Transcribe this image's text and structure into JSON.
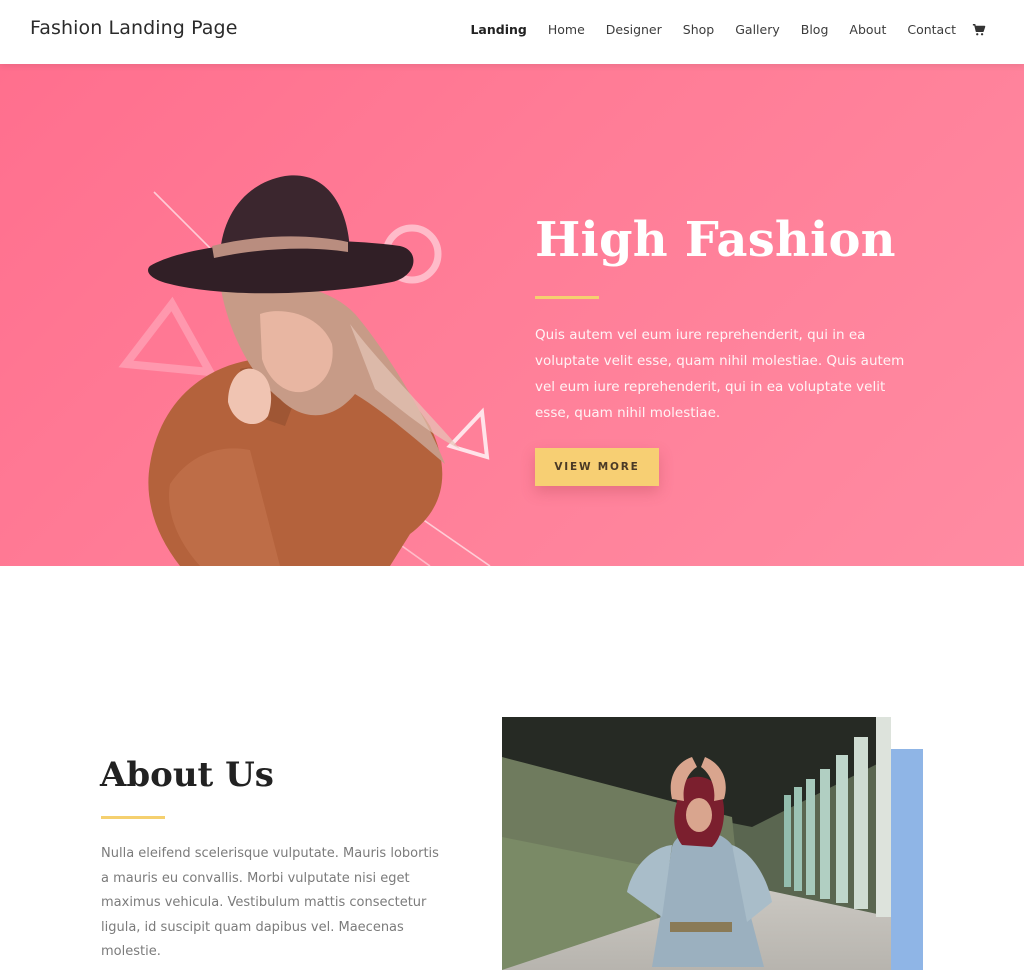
{
  "header": {
    "logo": "Fashion Landing Page",
    "nav": [
      "Landing",
      "Home",
      "Designer",
      "Shop",
      "Gallery",
      "Blog",
      "About",
      "Contact"
    ],
    "active_index": 0,
    "cart_icon": "shopping-cart-icon"
  },
  "hero": {
    "title": "High Fashion",
    "text": "Quis autem vel eum iure reprehenderit, qui in ea voluptate velit esse, quam nihil molestiae. Quis autem vel eum iure reprehenderit, qui in ea voluptate velit esse, quam nihil molestiae.",
    "button": "VIEW MORE",
    "image": "woman-in-black-hat-photo"
  },
  "about": {
    "title": "About Us",
    "text": "Nulla eleifend scelerisque vulputate. Mauris lobortis a mauris eu convallis. Morbi vulputate nisi eget maximus vehicula. Vestibulum mattis consectetur ligula, id suscipit quam dapibus vel. Maecenas molestie.",
    "image": "woman-in-colonnade-photo"
  },
  "colors": {
    "hero_bg": "#ff7d97",
    "accent_yellow": "#f7cf73",
    "accent_blue": "#8fb5e6"
  }
}
